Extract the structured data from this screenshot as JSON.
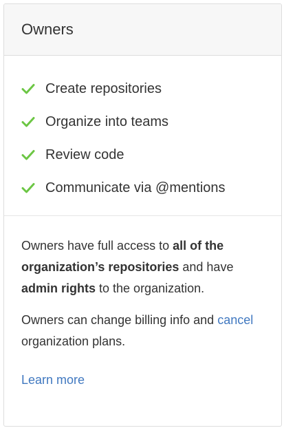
{
  "card": {
    "title": "Owners",
    "features": [
      {
        "label": "Create repositories",
        "icon": "check-icon"
      },
      {
        "label": "Organize into teams",
        "icon": "check-icon"
      },
      {
        "label": "Review code",
        "icon": "check-icon"
      },
      {
        "label": "Communicate via @mentions",
        "icon": "check-icon"
      }
    ],
    "description": {
      "part1": "Owners have full access to ",
      "bold1": "all of the organization’s repositories",
      "part2": " and have ",
      "bold2": "admin rights",
      "part3": " to the organization."
    },
    "billing": {
      "part1": "Owners can change billing info and ",
      "link_text": "cancel",
      "part2": " organization plans."
    },
    "learn_more": "Learn more"
  },
  "colors": {
    "check": "#6cc644",
    "link": "#4078c0",
    "text": "#333333",
    "border": "#dddddd"
  }
}
